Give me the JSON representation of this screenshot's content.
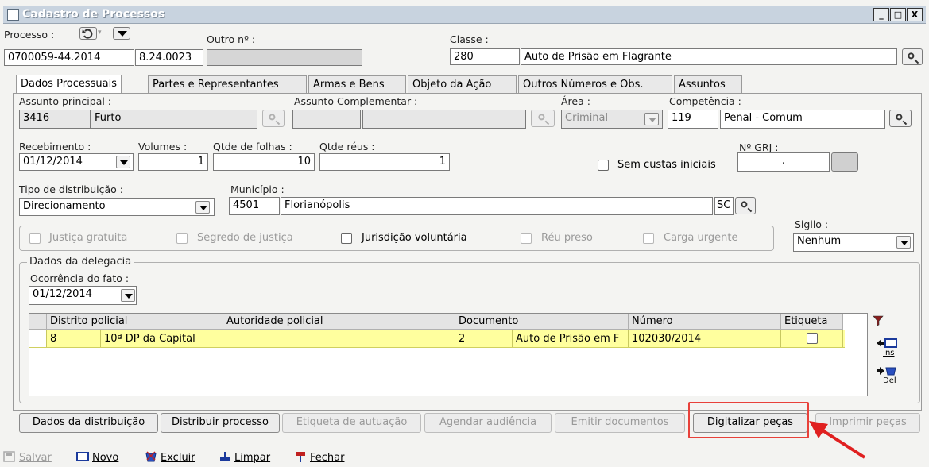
{
  "window": {
    "title": "Cadastro de Processos",
    "btn_min": "_",
    "btn_max": "□",
    "btn_close": "X"
  },
  "header": {
    "processo_label": "Processo :",
    "processo_number": "0700059-44.2014",
    "processo_origin": "8.24.0023",
    "outro_label": "Outro nº :",
    "outro_value": "",
    "classe_label": "Classe :",
    "classe_code": "280",
    "classe_name": "Auto de Prisão em Flagrante"
  },
  "tabs": [
    {
      "label": "Dados Processuais"
    },
    {
      "label": "Partes e Representantes"
    },
    {
      "label": "Armas e Bens"
    },
    {
      "label": "Objeto da Ação"
    },
    {
      "label": "Outros Números e Obs."
    },
    {
      "label": "Assuntos"
    }
  ],
  "form": {
    "assunto_principal_label": "Assunto principal :",
    "assunto_code": "3416",
    "assunto_name": "Furto",
    "assunto_comp_label": "Assunto Complementar :",
    "area_label": "Área :",
    "area_value": "Criminal",
    "competencia_label": "Competência :",
    "competencia_code": "119",
    "competencia_name": "Penal - Comum",
    "recebimento_label": "Recebimento :",
    "recebimento_value": "01/12/2014",
    "volumes_label": "Volumes :",
    "volumes_value": "1",
    "folhas_label": "Qtde de folhas :",
    "folhas_value": "10",
    "reus_label": "Qtde réus :",
    "reus_value": "1",
    "grj_label": "Nº GRJ :",
    "grj_value": ".",
    "sem_custas_label": "Sem custas iniciais",
    "tipo_label": "Tipo de distribuição :",
    "tipo_value": "Direcionamento",
    "municipio_label": "Município :",
    "municipio_code": "4501",
    "municipio_name": "Florianópolis",
    "uf": "SC",
    "sigilo_label": "Sigilo :",
    "sigilo_value": "Nenhum",
    "checks": {
      "justica": "Justiça gratuita",
      "segredo": "Segredo de justiça",
      "jurisdicao": "Jurisdição voluntária",
      "reu_preso": "Réu preso",
      "carga": "Carga urgente"
    }
  },
  "delegacia": {
    "legend": "Dados da delegacia",
    "ocorrencia_label": "Ocorrência do fato :",
    "ocorrencia_value": "01/12/2014",
    "columns": [
      "Distrito policial",
      "Autoridade policial",
      "Documento",
      "Número",
      "Etiqueta"
    ],
    "row": {
      "distrito_code": "8",
      "distrito_name": "10ª DP da Capital",
      "autoridade": "",
      "doc_code": "2",
      "doc_name": "Auto de Prisão em F",
      "numero": "102030/2014"
    },
    "ins_label": "Ins",
    "del_label": "Del"
  },
  "actions": [
    {
      "label": "Dados da distribuição"
    },
    {
      "label": "Distribuir processo"
    },
    {
      "label": "Etiqueta de autuação"
    },
    {
      "label": "Agendar audiência"
    },
    {
      "label": "Emitir documentos"
    },
    {
      "label": "Digitalizar peças"
    },
    {
      "label": "Imprimir peças"
    }
  ],
  "toolbar": {
    "salvar": "Salvar",
    "novo": "Novo",
    "excluir": "Excluir",
    "limpar": "Limpar",
    "fechar": "Fechar"
  },
  "colors": {
    "highlight_box": "#e8413a",
    "arrow": "#e02020",
    "row_bg": "#ffff9e"
  }
}
